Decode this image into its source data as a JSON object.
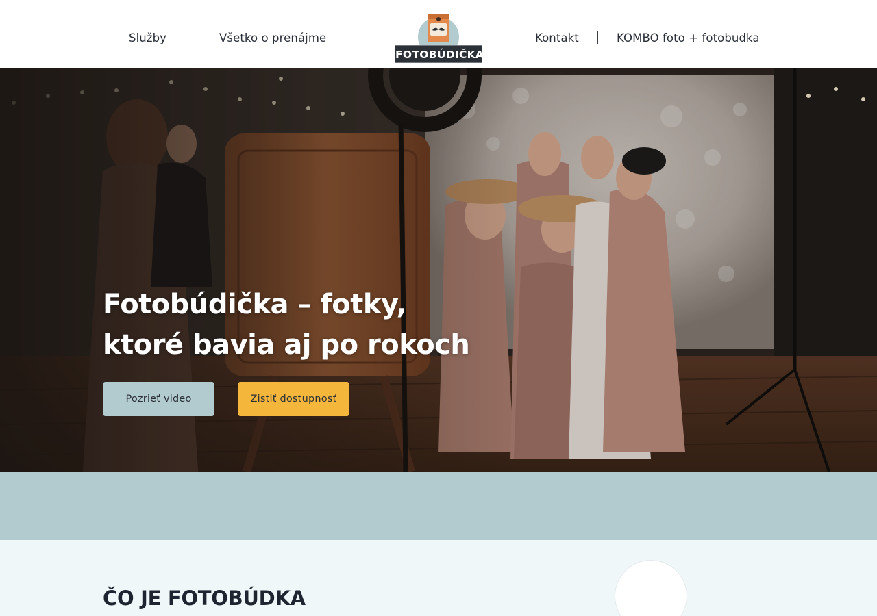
{
  "nav": {
    "left": [
      "Služby",
      "Všetko o prenájme"
    ],
    "right": [
      "Kontakt",
      "KOMBO foto + fotobudka"
    ]
  },
  "logo": {
    "text": "FOTOBÚDIČKA",
    "icon": "camera-mustache-icon"
  },
  "hero": {
    "title_line1": "Fotobúdička – fotky,",
    "title_line2": "ktoré bavia aj po rokoch",
    "btn_video": "Pozrieť video",
    "btn_availability": "Zistiť dostupnosť"
  },
  "section": {
    "title": "ČO JE FOTOBÚDKA"
  },
  "colors": {
    "accent_teal": "#b1cbce",
    "accent_yellow": "#f4b63b",
    "light_bg": "#eff7f8",
    "dark": "#2c3138"
  }
}
